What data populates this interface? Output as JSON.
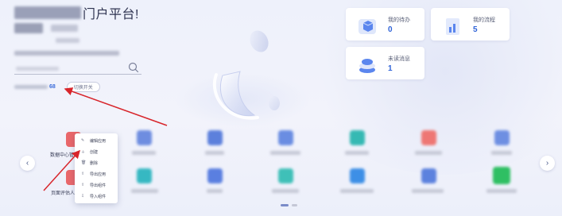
{
  "header": {
    "title_suffix": "门户平台!"
  },
  "shortcut": {
    "count": "68",
    "toggle_label": "切换开关"
  },
  "cards": [
    {
      "key": "todo",
      "label": "我的待办",
      "count": "0",
      "color": "#4f7ef0"
    },
    {
      "key": "process",
      "label": "我的流程",
      "count": "5",
      "color": "#4f7ef0"
    },
    {
      "key": "unread",
      "label": "未读消息",
      "count": "1",
      "color": "#4f7ef0"
    }
  ],
  "context_menu": {
    "items": [
      {
        "icon": "pencil-icon",
        "label": "编辑应用"
      },
      {
        "icon": "plus-icon",
        "label": "创建"
      },
      {
        "icon": "trash-icon",
        "label": "删除"
      },
      {
        "icon": "export-icon",
        "label": "导出应用"
      },
      {
        "icon": "export-icon",
        "label": "导出组件"
      },
      {
        "icon": "import-icon",
        "label": "导入组件"
      }
    ]
  },
  "apps": {
    "row1_first_label": "数据中心管理",
    "row2_first_label": "页面评估人员"
  },
  "colors": {
    "accent": "#3a6ad9",
    "arrow_red": "#d8252b"
  }
}
